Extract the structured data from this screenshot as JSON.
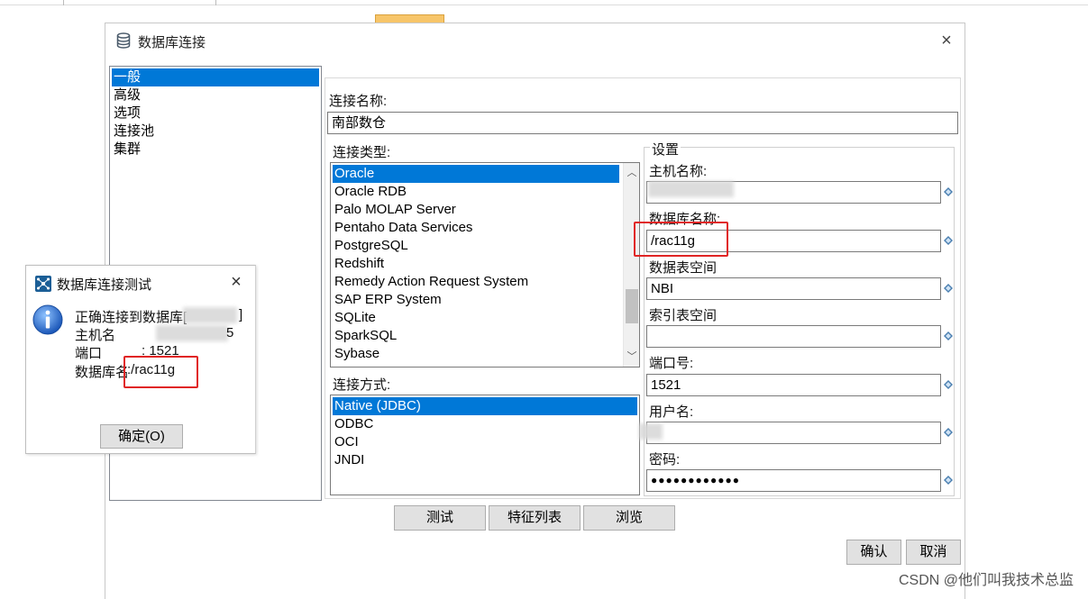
{
  "main_dialog": {
    "title": "数据库连接",
    "close_glyph": "×",
    "categories": [
      {
        "label": "一般",
        "selected": true
      },
      {
        "label": "高级",
        "selected": false
      },
      {
        "label": "选项",
        "selected": false
      },
      {
        "label": "连接池",
        "selected": false
      },
      {
        "label": "集群",
        "selected": false
      }
    ],
    "connection_name_label": "连接名称:",
    "connection_name_value": "南部数仓",
    "connection_type_label": "连接类型:",
    "connection_types": [
      {
        "label": "Oracle",
        "selected": true
      },
      {
        "label": "Oracle RDB",
        "selected": false
      },
      {
        "label": "Palo MOLAP Server",
        "selected": false
      },
      {
        "label": "Pentaho Data Services",
        "selected": false
      },
      {
        "label": "PostgreSQL",
        "selected": false
      },
      {
        "label": "Redshift",
        "selected": false
      },
      {
        "label": "Remedy Action Request System",
        "selected": false
      },
      {
        "label": "SAP ERP System",
        "selected": false
      },
      {
        "label": "SQLite",
        "selected": false
      },
      {
        "label": "SparkSQL",
        "selected": false
      },
      {
        "label": "Sybase",
        "selected": false
      }
    ],
    "access_label": "连接方式:",
    "access_methods": [
      {
        "label": "Native (JDBC)",
        "selected": true
      },
      {
        "label": "ODBC",
        "selected": false
      },
      {
        "label": "OCI",
        "selected": false
      },
      {
        "label": "JNDI",
        "selected": false
      }
    ],
    "settings": {
      "group_label": "设置",
      "host_label": "主机名称:",
      "host_value": "",
      "dbname_label": "数据库名称:",
      "dbname_value": "/rac11g",
      "data_tablespace_label": "数据表空间",
      "data_tablespace_value": "NBI",
      "index_tablespace_label": "索引表空间",
      "index_tablespace_value": "",
      "port_label": "端口号:",
      "port_value": "1521",
      "user_label": "用户名:",
      "user_value": "",
      "password_label": "密码:",
      "password_value": "●●●●●●●●●●●●"
    },
    "buttons": {
      "test": "测试",
      "features": "特征列表",
      "explore": "浏览",
      "ok": "确认",
      "cancel": "取消"
    }
  },
  "test_dialog": {
    "title": "数据库连接测试",
    "close_glyph": "×",
    "line1": "正确连接到数据库[",
    "line1_end": "]",
    "host_label": "主机名",
    "host_suffix": "5",
    "port_label": "端口",
    "port_value": ": 1521",
    "dbname_label": "数据库名",
    "dbname_value": ":/rac11g",
    "ok_button": "确定(O)"
  },
  "corner_watermark": "CSDN @他们叫我技术总监",
  "colors": {
    "selection": "#0078d7",
    "highlight_box": "#e02424",
    "button_face": "#e1e1e1"
  }
}
